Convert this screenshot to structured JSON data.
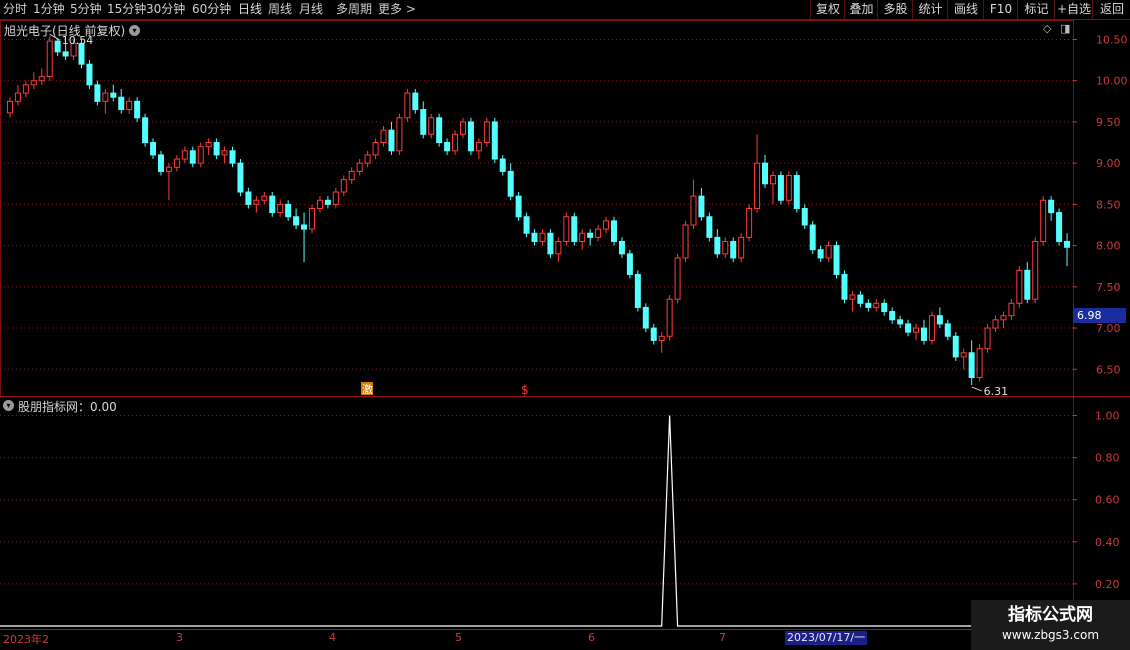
{
  "toolbar": {
    "left": [
      {
        "label": "分时",
        "active": false
      },
      {
        "label": "1分钟",
        "active": false
      },
      {
        "label": "5分钟",
        "active": false
      },
      {
        "label": "15分钟",
        "active": false
      },
      {
        "label": "30分钟",
        "active": false
      },
      {
        "label": "60分钟",
        "active": false
      },
      {
        "label": "日线",
        "active": true
      },
      {
        "label": "周线",
        "active": false
      },
      {
        "label": "月线",
        "active": false
      },
      {
        "label": "多周期",
        "active": false
      },
      {
        "label": "更多 >",
        "active": false
      }
    ],
    "right": [
      "复权",
      "叠加",
      "多股",
      "统计",
      "画线",
      "F10",
      "标记",
      "+自选",
      "返回"
    ]
  },
  "main": {
    "stock_title": "旭光电子(日线 前复权)",
    "high_label": "10.54",
    "low_label": "6.31",
    "current_price_tag": "6.98",
    "markers": [
      "激",
      "$"
    ],
    "y_ticks": [
      "10.50",
      "10.00",
      "9.50",
      "9.00",
      "8.50",
      "8.00",
      "7.50",
      "7.00",
      "6.50"
    ]
  },
  "indicator": {
    "title": "股朋指标网：0.00",
    "y_ticks": [
      "1.00",
      "0.80",
      "0.60",
      "0.40",
      "0.20"
    ]
  },
  "date_axis": {
    "labels": [
      "2023年2",
      "3",
      "4",
      "5",
      "6",
      "7"
    ],
    "highlight": "2023/07/17/一"
  },
  "watermark": {
    "title": "指标公式网",
    "url": "www.zbgs3.com"
  },
  "colors": {
    "up": "#ff3b3b",
    "down": "#54ffff",
    "grid": "#8a1a1a",
    "axis": "#c83a3a",
    "highlight": "#1b1f8a"
  },
  "chart_data": [
    {
      "type": "candlestick",
      "title": "旭光电子(日线 前复权)",
      "ylim": [
        6.2,
        10.7
      ],
      "y_ticks": [
        10.5,
        10.0,
        9.5,
        9.0,
        8.5,
        8.0,
        7.5,
        7.0,
        6.5
      ],
      "high": 10.54,
      "low": 6.31,
      "last": 6.98,
      "candles": [
        [
          9.61,
          9.8,
          9.55,
          9.75
        ],
        [
          9.75,
          9.95,
          9.7,
          9.85
        ],
        [
          9.85,
          10.0,
          9.8,
          9.95
        ],
        [
          9.95,
          10.1,
          9.9,
          10.0
        ],
        [
          10.0,
          10.15,
          9.95,
          10.05
        ],
        [
          10.05,
          10.54,
          10.0,
          10.48
        ],
        [
          10.48,
          10.52,
          10.3,
          10.35
        ],
        [
          10.35,
          10.45,
          10.25,
          10.3
        ],
        [
          10.3,
          10.5,
          10.25,
          10.45
        ],
        [
          10.45,
          10.5,
          10.15,
          10.2
        ],
        [
          10.2,
          10.25,
          9.9,
          9.95
        ],
        [
          9.95,
          10.0,
          9.7,
          9.75
        ],
        [
          9.75,
          9.9,
          9.6,
          9.85
        ],
        [
          9.85,
          9.95,
          9.75,
          9.8
        ],
        [
          9.8,
          9.9,
          9.6,
          9.65
        ],
        [
          9.65,
          9.8,
          9.6,
          9.75
        ],
        [
          9.75,
          9.8,
          9.5,
          9.55
        ],
        [
          9.55,
          9.6,
          9.2,
          9.25
        ],
        [
          9.25,
          9.3,
          9.05,
          9.1
        ],
        [
          9.1,
          9.15,
          8.85,
          8.9
        ],
        [
          8.9,
          9.0,
          8.55,
          8.95
        ],
        [
          8.95,
          9.1,
          8.9,
          9.05
        ],
        [
          9.05,
          9.2,
          9.0,
          9.15
        ],
        [
          9.15,
          9.2,
          8.95,
          9.0
        ],
        [
          9.0,
          9.25,
          8.95,
          9.2
        ],
        [
          9.2,
          9.3,
          9.1,
          9.25
        ],
        [
          9.25,
          9.3,
          9.05,
          9.1
        ],
        [
          9.1,
          9.2,
          9.0,
          9.15
        ],
        [
          9.15,
          9.2,
          8.95,
          9.0
        ],
        [
          9.0,
          9.05,
          8.6,
          8.65
        ],
        [
          8.65,
          8.7,
          8.45,
          8.5
        ],
        [
          8.5,
          8.6,
          8.4,
          8.55
        ],
        [
          8.55,
          8.65,
          8.5,
          8.6
        ],
        [
          8.6,
          8.65,
          8.35,
          8.4
        ],
        [
          8.4,
          8.55,
          8.35,
          8.5
        ],
        [
          8.5,
          8.55,
          8.3,
          8.35
        ],
        [
          8.35,
          8.45,
          8.2,
          8.25
        ],
        [
          8.25,
          8.4,
          7.8,
          8.2
        ],
        [
          8.2,
          8.5,
          8.15,
          8.45
        ],
        [
          8.45,
          8.6,
          8.4,
          8.55
        ],
        [
          8.55,
          8.6,
          8.45,
          8.5
        ],
        [
          8.5,
          8.7,
          8.45,
          8.65
        ],
        [
          8.65,
          8.85,
          8.6,
          8.8
        ],
        [
          8.8,
          8.95,
          8.75,
          8.9
        ],
        [
          8.9,
          9.05,
          8.85,
          9.0
        ],
        [
          9.0,
          9.15,
          8.95,
          9.1
        ],
        [
          9.1,
          9.3,
          9.05,
          9.25
        ],
        [
          9.25,
          9.45,
          9.2,
          9.4
        ],
        [
          9.4,
          9.5,
          9.1,
          9.15
        ],
        [
          9.15,
          9.6,
          9.1,
          9.55
        ],
        [
          9.55,
          9.9,
          9.5,
          9.85
        ],
        [
          9.85,
          9.9,
          9.6,
          9.65
        ],
        [
          9.65,
          9.75,
          9.3,
          9.35
        ],
        [
          9.35,
          9.6,
          9.3,
          9.55
        ],
        [
          9.55,
          9.6,
          9.2,
          9.25
        ],
        [
          9.25,
          9.3,
          9.1,
          9.15
        ],
        [
          9.15,
          9.4,
          9.1,
          9.35
        ],
        [
          9.35,
          9.55,
          9.3,
          9.5
        ],
        [
          9.5,
          9.55,
          9.1,
          9.15
        ],
        [
          9.15,
          9.3,
          9.05,
          9.25
        ],
        [
          9.25,
          9.55,
          9.2,
          9.5
        ],
        [
          9.5,
          9.55,
          9.0,
          9.05
        ],
        [
          9.05,
          9.1,
          8.85,
          8.9
        ],
        [
          8.9,
          9.0,
          8.55,
          8.6
        ],
        [
          8.6,
          8.65,
          8.3,
          8.35
        ],
        [
          8.35,
          8.4,
          8.1,
          8.15
        ],
        [
          8.15,
          8.2,
          8.0,
          8.05
        ],
        [
          8.05,
          8.2,
          8.0,
          8.15
        ],
        [
          8.15,
          8.2,
          7.85,
          7.9
        ],
        [
          7.9,
          8.1,
          7.8,
          8.05
        ],
        [
          8.05,
          8.4,
          8.0,
          8.35
        ],
        [
          8.35,
          8.4,
          8.0,
          8.05
        ],
        [
          8.05,
          8.2,
          7.95,
          8.15
        ],
        [
          8.15,
          8.2,
          8.0,
          8.1
        ],
        [
          8.1,
          8.25,
          8.05,
          8.2
        ],
        [
          8.2,
          8.35,
          8.15,
          8.3
        ],
        [
          8.3,
          8.35,
          8.0,
          8.05
        ],
        [
          8.05,
          8.1,
          7.85,
          7.9
        ],
        [
          7.9,
          7.95,
          7.6,
          7.65
        ],
        [
          7.65,
          7.7,
          7.2,
          7.25
        ],
        [
          7.25,
          7.3,
          6.95,
          7.0
        ],
        [
          7.0,
          7.05,
          6.8,
          6.85
        ],
        [
          6.85,
          6.95,
          6.7,
          6.9
        ],
        [
          6.9,
          7.4,
          6.85,
          7.35
        ],
        [
          7.35,
          7.9,
          7.3,
          7.85
        ],
        [
          7.85,
          8.3,
          7.8,
          8.25
        ],
        [
          8.25,
          8.8,
          8.2,
          8.6
        ],
        [
          8.6,
          8.7,
          8.3,
          8.35
        ],
        [
          8.35,
          8.4,
          8.05,
          8.1
        ],
        [
          8.1,
          8.2,
          7.85,
          7.9
        ],
        [
          7.9,
          8.1,
          7.85,
          8.05
        ],
        [
          8.05,
          8.1,
          7.8,
          7.85
        ],
        [
          7.85,
          8.15,
          7.8,
          8.1
        ],
        [
          8.1,
          8.5,
          8.05,
          8.45
        ],
        [
          8.45,
          9.35,
          8.4,
          9.0
        ],
        [
          9.0,
          9.1,
          8.7,
          8.75
        ],
        [
          8.75,
          8.9,
          8.5,
          8.85
        ],
        [
          8.85,
          8.9,
          8.5,
          8.55
        ],
        [
          8.55,
          8.9,
          8.5,
          8.85
        ],
        [
          8.85,
          8.9,
          8.4,
          8.45
        ],
        [
          8.45,
          8.5,
          8.2,
          8.25
        ],
        [
          8.25,
          8.3,
          7.9,
          7.95
        ],
        [
          7.95,
          8.0,
          7.8,
          7.85
        ],
        [
          7.85,
          8.05,
          7.8,
          8.0
        ],
        [
          8.0,
          8.05,
          7.6,
          7.65
        ],
        [
          7.65,
          7.7,
          7.3,
          7.35
        ],
        [
          7.35,
          7.45,
          7.2,
          7.4
        ],
        [
          7.4,
          7.45,
          7.25,
          7.3
        ],
        [
          7.3,
          7.35,
          7.2,
          7.25
        ],
        [
          7.25,
          7.35,
          7.2,
          7.3
        ],
        [
          7.3,
          7.35,
          7.15,
          7.2
        ],
        [
          7.2,
          7.25,
          7.05,
          7.1
        ],
        [
          7.1,
          7.15,
          7.0,
          7.05
        ],
        [
          7.05,
          7.1,
          6.9,
          6.95
        ],
        [
          6.95,
          7.05,
          6.85,
          7.0
        ],
        [
          7.0,
          7.1,
          6.8,
          6.85
        ],
        [
          6.85,
          7.2,
          6.8,
          7.15
        ],
        [
          7.15,
          7.25,
          7.0,
          7.05
        ],
        [
          7.05,
          7.1,
          6.85,
          6.9
        ],
        [
          6.9,
          6.95,
          6.6,
          6.65
        ],
        [
          6.65,
          6.75,
          6.5,
          6.7
        ],
        [
          6.7,
          6.85,
          6.31,
          6.4
        ],
        [
          6.4,
          6.8,
          6.35,
          6.75
        ],
        [
          6.75,
          7.05,
          6.7,
          7.0
        ],
        [
          7.0,
          7.15,
          6.95,
          7.1
        ],
        [
          7.1,
          7.2,
          7.0,
          7.15
        ],
        [
          7.15,
          7.35,
          7.1,
          7.3
        ],
        [
          7.3,
          7.75,
          7.25,
          7.7
        ],
        [
          7.7,
          7.8,
          7.3,
          7.35
        ],
        [
          7.35,
          8.1,
          7.3,
          8.05
        ],
        [
          8.05,
          8.6,
          8.0,
          8.55
        ],
        [
          8.55,
          8.6,
          8.3,
          8.4
        ],
        [
          8.4,
          8.45,
          8.0,
          8.05
        ],
        [
          8.05,
          8.15,
          7.75,
          7.98
        ]
      ]
    },
    {
      "type": "line",
      "title": "股朋指标网",
      "ylim": [
        0,
        1.05
      ],
      "y_ticks": [
        1.0,
        0.8,
        0.6,
        0.4,
        0.2
      ],
      "series": [
        {
          "values_nonzero_index": 83,
          "peak": 1.0,
          "baseline": 0.0
        }
      ]
    }
  ]
}
